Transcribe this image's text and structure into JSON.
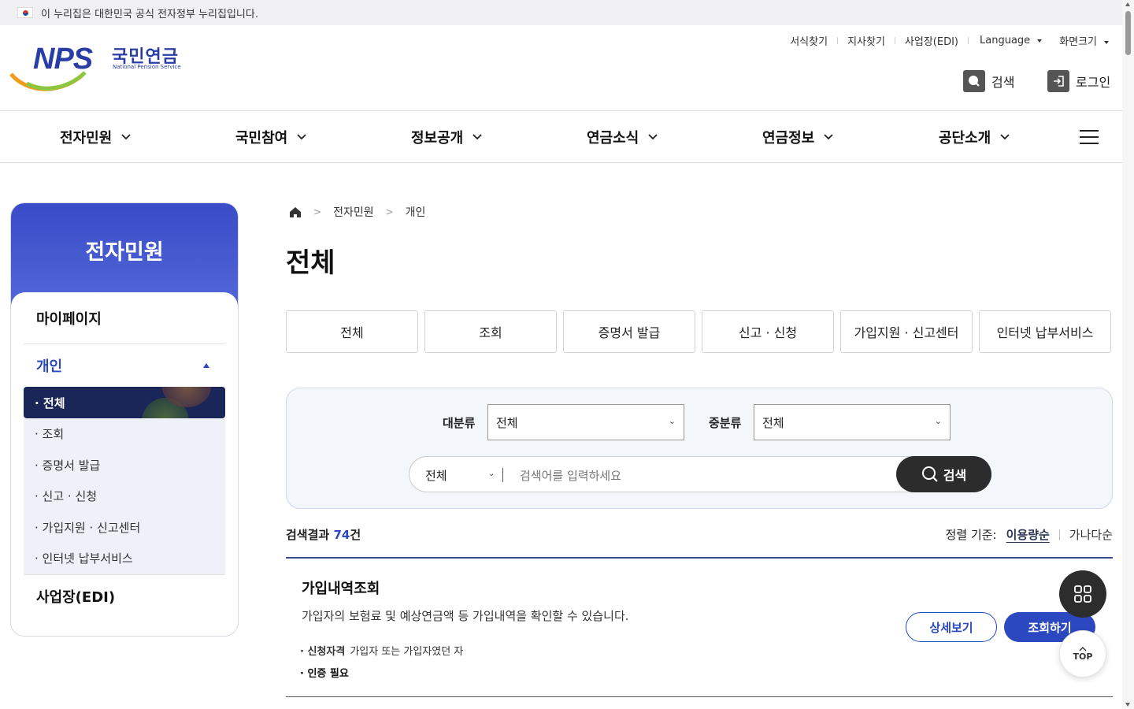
{
  "gov_banner": {
    "text": "이 누리집은 대한민국 공식 전자정부 누리집입니다."
  },
  "logo": {
    "abbr": "NPS",
    "name_ko": "국민연금",
    "name_en": "National Pension Service"
  },
  "util_links": [
    "서식찾기",
    "지사찾기",
    "사업장(EDI)"
  ],
  "language_label": "Language",
  "font_size_label": "화면크기",
  "header_search_label": "검색",
  "header_login_label": "로그인",
  "gnb": [
    "전자민원",
    "국민참여",
    "정보공개",
    "연금소식",
    "연금정보",
    "공단소개"
  ],
  "sidebar": {
    "title": "전자민원",
    "mypage": "마이페이지",
    "open_group": "개인",
    "sub_items": [
      "· 전체",
      "· 조회",
      "· 증명서 발급",
      "· 신고 · 신청",
      "· 가입지원 · 신고센터",
      "· 인터넷 납부서비스"
    ],
    "edi": "사업장(EDI)"
  },
  "breadcrumb": [
    "전자민원",
    "개인"
  ],
  "page_title": "전체",
  "tabs": [
    "전체",
    "조회",
    "증명서 발급",
    "신고 · 신청",
    "가입지원 · 신고센터",
    "인터넷 납부서비스"
  ],
  "filter": {
    "major_label": "대분류",
    "major_value": "전체",
    "minor_label": "중분류",
    "minor_value": "전체",
    "search_category": "전체",
    "search_placeholder": "검색어를 입력하세요",
    "search_button": "검색"
  },
  "results": {
    "prefix": "검색결과 ",
    "count": "74",
    "suffix": "건"
  },
  "sort": {
    "label": "정렬 기준:",
    "options": [
      "이용량순",
      "가나다순"
    ],
    "active": "이용량순"
  },
  "item": {
    "title": "가입내역조회",
    "desc": "가입자의 보험료 및 예상연금액 등 가입내역을 확인할 수 있습니다.",
    "meta1_label": "· 신청자격",
    "meta1_value": "가입자 또는 가입자였던 자",
    "meta2": "· 인증 필요",
    "btn_detail": "상세보기",
    "btn_query": "조회하기"
  },
  "fab": {
    "top_label": "TOP"
  },
  "colors": {
    "primary": "#2b48c0",
    "sidebar_active": "#1a2558",
    "dark": "#2c2c2c"
  }
}
